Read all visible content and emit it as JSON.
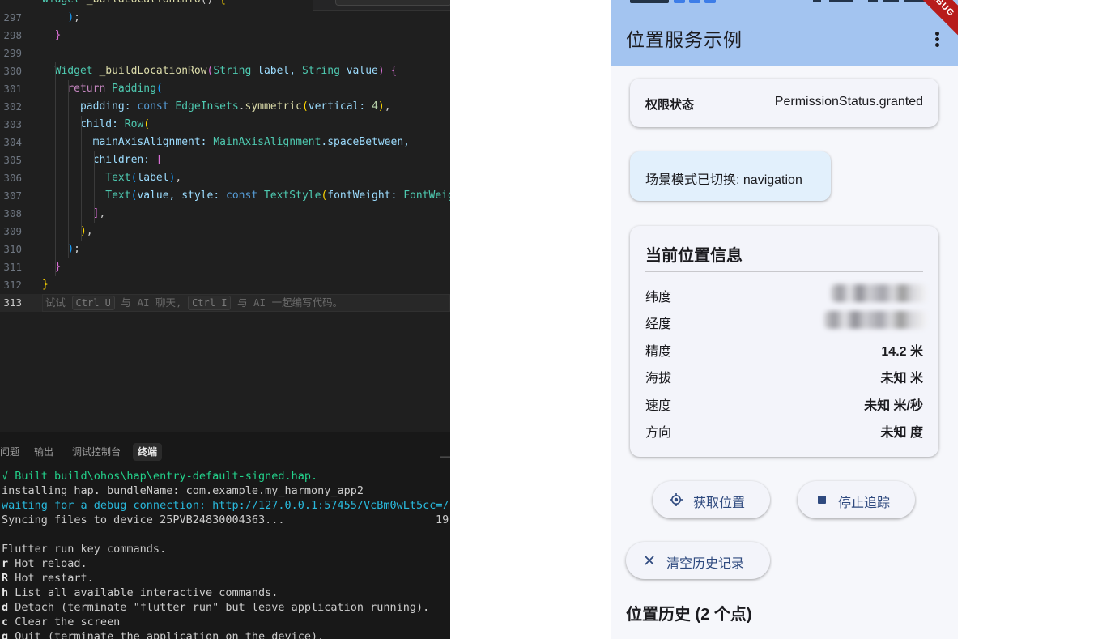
{
  "editor": {
    "lines": [
      {
        "num": "",
        "tokens": [
          {
            "t": "Widget ",
            "c": "k-type"
          },
          {
            "t": "_buildLocationInfo",
            "c": "k-fn"
          },
          {
            "t": "() ",
            "c": ""
          },
          {
            "t": "{",
            "c": "k-y"
          }
        ]
      },
      {
        "num": "297",
        "tokens": [
          {
            "t": "    ",
            "c": ""
          },
          {
            "t": ")",
            "c": "k-b"
          },
          {
            "t": ";",
            "c": ""
          }
        ]
      },
      {
        "num": "298",
        "tokens": [
          {
            "t": "  ",
            "c": ""
          },
          {
            "t": "}",
            "c": "k-p"
          }
        ]
      },
      {
        "num": "299",
        "tokens": []
      },
      {
        "num": "300",
        "tokens": [
          {
            "t": "  ",
            "c": ""
          },
          {
            "t": "Widget ",
            "c": "k-type"
          },
          {
            "t": "_buildLocationRow",
            "c": "k-fn"
          },
          {
            "t": "(",
            "c": "k-p"
          },
          {
            "t": "String ",
            "c": "k-type"
          },
          {
            "t": "label, ",
            "c": "k-var"
          },
          {
            "t": "String ",
            "c": "k-type"
          },
          {
            "t": "value",
            "c": "k-var"
          },
          {
            "t": ") ",
            "c": "k-p"
          },
          {
            "t": "{",
            "c": "k-p"
          }
        ]
      },
      {
        "num": "301",
        "tokens": [
          {
            "t": "    ",
            "c": ""
          },
          {
            "t": "return ",
            "c": "k-purple"
          },
          {
            "t": "Padding",
            "c": "k-type"
          },
          {
            "t": "(",
            "c": "k-b"
          }
        ]
      },
      {
        "num": "302",
        "tokens": [
          {
            "t": "      ",
            "c": ""
          },
          {
            "t": "padding: ",
            "c": "k-var"
          },
          {
            "t": "const ",
            "c": "k-blue"
          },
          {
            "t": "EdgeInsets",
            "c": "k-type"
          },
          {
            "t": ".",
            "c": ""
          },
          {
            "t": "symmetric",
            "c": "k-fn"
          },
          {
            "t": "(",
            "c": "k-y"
          },
          {
            "t": "vertical: ",
            "c": "k-var"
          },
          {
            "t": "4",
            "c": "k-num"
          },
          {
            "t": ")",
            "c": "k-y"
          },
          {
            "t": ",",
            "c": ""
          }
        ]
      },
      {
        "num": "303",
        "tokens": [
          {
            "t": "      ",
            "c": ""
          },
          {
            "t": "child: ",
            "c": "k-var"
          },
          {
            "t": "Row",
            "c": "k-type"
          },
          {
            "t": "(",
            "c": "k-y"
          }
        ]
      },
      {
        "num": "304",
        "tokens": [
          {
            "t": "        ",
            "c": ""
          },
          {
            "t": "mainAxisAlignment: ",
            "c": "k-var"
          },
          {
            "t": "MainAxisAlignment",
            "c": "k-type"
          },
          {
            "t": ".spaceBetween,",
            "c": "k-var"
          }
        ]
      },
      {
        "num": "305",
        "tokens": [
          {
            "t": "        ",
            "c": ""
          },
          {
            "t": "children: ",
            "c": "k-var"
          },
          {
            "t": "[",
            "c": "k-p"
          }
        ]
      },
      {
        "num": "306",
        "tokens": [
          {
            "t": "          ",
            "c": ""
          },
          {
            "t": "Text",
            "c": "k-type"
          },
          {
            "t": "(",
            "c": "k-b"
          },
          {
            "t": "label",
            "c": "k-var"
          },
          {
            "t": ")",
            "c": "k-b"
          },
          {
            "t": ",",
            "c": ""
          }
        ]
      },
      {
        "num": "307",
        "tokens": [
          {
            "t": "          ",
            "c": ""
          },
          {
            "t": "Text",
            "c": "k-type"
          },
          {
            "t": "(",
            "c": "k-b"
          },
          {
            "t": "value, ",
            "c": "k-var"
          },
          {
            "t": "style: ",
            "c": "k-var"
          },
          {
            "t": "const ",
            "c": "k-blue"
          },
          {
            "t": "TextStyle",
            "c": "k-type"
          },
          {
            "t": "(",
            "c": "k-y"
          },
          {
            "t": "fontWeight: ",
            "c": "k-var"
          },
          {
            "t": "FontWeig",
            "c": "k-type"
          }
        ]
      },
      {
        "num": "308",
        "tokens": [
          {
            "t": "        ",
            "c": ""
          },
          {
            "t": "]",
            "c": "k-p"
          },
          {
            "t": ",",
            "c": ""
          }
        ]
      },
      {
        "num": "309",
        "tokens": [
          {
            "t": "      ",
            "c": ""
          },
          {
            "t": ")",
            "c": "k-y"
          },
          {
            "t": ",",
            "c": ""
          }
        ]
      },
      {
        "num": "310",
        "tokens": [
          {
            "t": "    ",
            "c": ""
          },
          {
            "t": ")",
            "c": "k-b"
          },
          {
            "t": ";",
            "c": ""
          }
        ]
      },
      {
        "num": "311",
        "tokens": [
          {
            "t": "  ",
            "c": ""
          },
          {
            "t": "}",
            "c": "k-p"
          }
        ]
      },
      {
        "num": "312",
        "tokens": [
          {
            "t": "}",
            "c": "k-y"
          }
        ]
      }
    ],
    "current_line": {
      "num": "313",
      "hint_parts": [
        {
          "t": "试试 ",
          "kbd": false
        },
        {
          "t": "Ctrl U",
          "kbd": true
        },
        {
          "t": " 与 AI 聊天, ",
          "kbd": false
        },
        {
          "t": "Ctrl I",
          "kbd": true
        },
        {
          "t": " 与 AI 一起编写代码。",
          "kbd": false
        }
      ]
    }
  },
  "panel": {
    "tabs": [
      {
        "label": "问题",
        "active": false
      },
      {
        "label": "输出",
        "active": false
      },
      {
        "label": "调试控制台",
        "active": false
      },
      {
        "label": "终端",
        "active": true
      }
    ],
    "dash": "—",
    "terminal_lines": [
      {
        "text": "√ Built build\\ohos\\hap\\entry-default-signed.hap.",
        "style": "t-green",
        "bold_first": false
      },
      {
        "text": "installing hap. bundleName: com.example.my_harmony_app2",
        "style": "",
        "bold_first": false
      },
      {
        "text": "waiting for a debug connection: http://127.0.0.1:57455/VcBm0wLt5cc=/",
        "style": "t-cyan",
        "bold_first": false
      },
      {
        "text": "Syncing files to device 25PVB24830004363...",
        "style": "",
        "bold_first": false,
        "right": "19"
      },
      {
        "text": "",
        "style": "",
        "bold_first": false
      },
      {
        "text": "Flutter run key commands.",
        "style": "",
        "bold_first": false
      },
      {
        "text": "r Hot reload.",
        "style": "",
        "bold_first": true
      },
      {
        "text": "R Hot restart.",
        "style": "",
        "bold_first": true
      },
      {
        "text": "h List all available interactive commands.",
        "style": "",
        "bold_first": true
      },
      {
        "text": "d Detach (terminate \"flutter run\" but leave application running).",
        "style": "",
        "bold_first": true
      },
      {
        "text": "c Clear the screen",
        "style": "",
        "bold_first": true
      },
      {
        "text": "q Quit (terminate the application on the device).",
        "style": "",
        "bold_first": true
      }
    ]
  },
  "app": {
    "title": "位置服务示例",
    "debug_banner": "DEBUG",
    "permission": {
      "label": "权限状态",
      "value": "PermissionStatus.granted"
    },
    "scene": {
      "text": "场景模式已切换: navigation"
    },
    "info": {
      "title": "当前位置信息",
      "rows": [
        {
          "label": "纬度",
          "value": "",
          "blurred": true,
          "blur_width": 118
        },
        {
          "label": "经度",
          "value": "",
          "blurred": true,
          "blur_width": 126
        },
        {
          "label": "精度",
          "value": "14.2 米",
          "blurred": false
        },
        {
          "label": "海拔",
          "value": "未知 米",
          "blurred": false
        },
        {
          "label": "速度",
          "value": "未知 米/秒",
          "blurred": false
        },
        {
          "label": "方向",
          "value": "未知 度",
          "blurred": false
        }
      ]
    },
    "buttons": {
      "get_location": "获取位置",
      "stop_tracking": "停止追踪",
      "clear_history": "清空历史记录"
    },
    "history_title": "位置历史 (2 个点)"
  },
  "icons": {
    "get_location": "my-location-icon",
    "stop_tracking": "stop-icon",
    "clear_history": "close-icon",
    "more": "more-vert-icon"
  },
  "colors": {
    "appbar": "#a3c4f0",
    "button_text": "#2f4a7f",
    "scene_card": "#e2f0fc",
    "debug_banner": "#b71c1c",
    "terminal_green": "#23d18b",
    "terminal_cyan": "#29b8db"
  }
}
